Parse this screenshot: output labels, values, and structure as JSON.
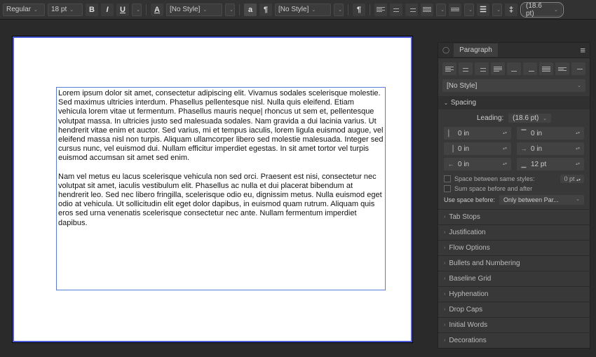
{
  "toolbar": {
    "fontWeight": "Regular",
    "fontSize": "18 pt",
    "bold": "B",
    "italic": "I",
    "underline": "U",
    "charStyle": "[No Style]",
    "paraStyle": "[No Style]",
    "leading": "(18.6 pt)"
  },
  "document": {
    "para1": "Lorem ipsum dolor sit amet, consectetur adipiscing elit. Vivamus sodales scelerisque molestie. Sed maximus ultricies interdum. Phasellus pellentesque nisl. Nulla quis eleifend. Etiam vehicula lorem vitae ut fermentum. Phasellus mauris neque| rhoncus ut sem et, pellentesque volutpat massa. In ultricies justo sed malesuada sodales. Nam gravida a dui lacinia varius. Ut hendrerit vitae enim et auctor. Sed varius, mi et tempus iaculis, lorem ligula euismod augue, vel eleifend massa nisl non turpis. Aliquam ullamcorper libero sed molestie malesuada. Integer sed cursus nunc, vel euismod dui. Nullam efficitur imperdiet egestas. In sit amet tortor vel turpis euismod accumsan sit amet sed enim.",
    "para2": "Nam vel metus eu lacus scelerisque vehicula non sed orci. Praesent est nisi, consectetur nec volutpat sit amet, iaculis vestibulum elit. Phasellus ac nulla et dui placerat bibendum at hendrerit leo. Sed nec libero fringilla, scelerisque odio eu, dignissim metus. Nulla euismod eget odio at vehicula. Ut sollicitudin elit eget dolor dapibus, in euismod quam rutrum. Aliquam quis eros sed urna venenatis scelerisque consectetur nec ante. Nullam fermentum imperdiet dapibus."
  },
  "panel": {
    "title": "Paragraph",
    "style": "[No Style]",
    "sections": {
      "spacing": "Spacing",
      "tabStops": "Tab Stops",
      "justification": "Justification",
      "flowOptions": "Flow Options",
      "bullets": "Bullets and Numbering",
      "baselineGrid": "Baseline Grid",
      "hyphenation": "Hyphenation",
      "dropCaps": "Drop Caps",
      "initialWords": "Initial Words",
      "decorations": "Decorations"
    },
    "spacing": {
      "leadingLabel": "Leading:",
      "leadingValue": "(18.6 pt)",
      "leftIndent": "0 in",
      "spaceBefore": "0 in",
      "rightIndent": "0 in",
      "firstLine": "0 in",
      "lastLine": "0 in",
      "spaceAfter": "12 pt",
      "sameStylesLabel": "Space between same styles:",
      "sameStylesValue": "0 pt",
      "sumLabel": "Sum space before and after",
      "useSpaceLabel": "Use space before:",
      "useSpaceValue": "Only between Par..."
    }
  }
}
